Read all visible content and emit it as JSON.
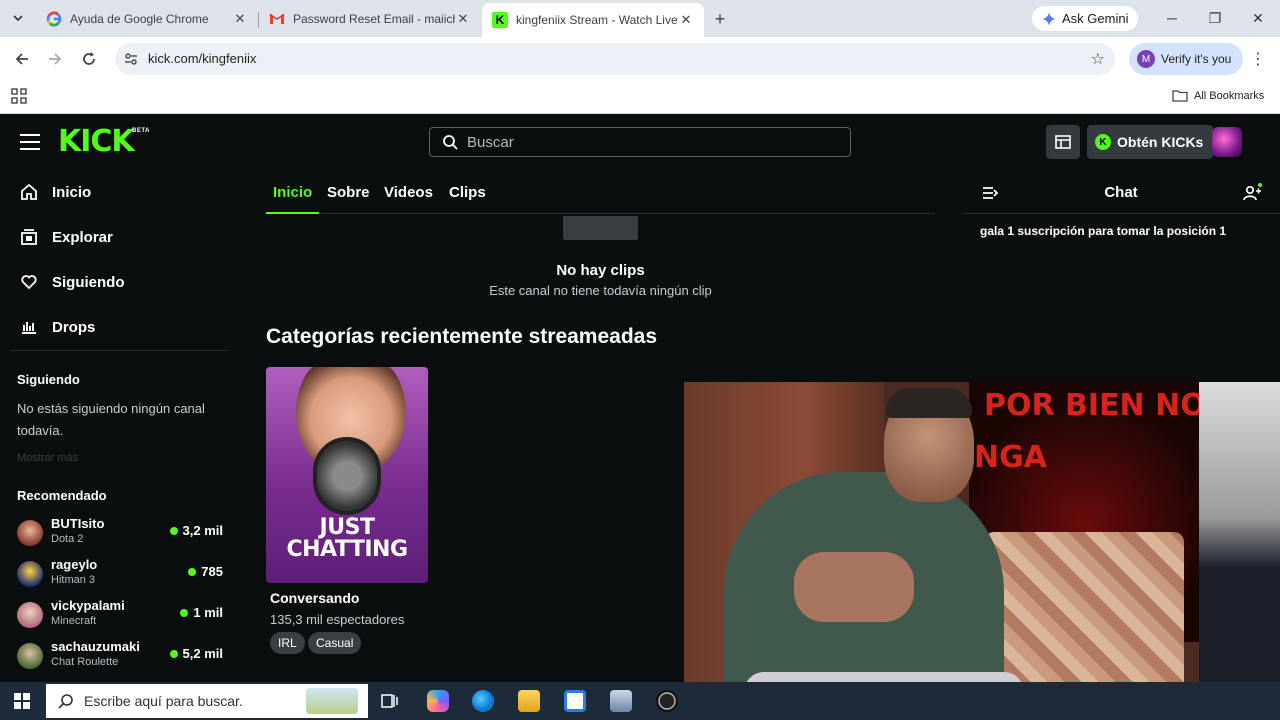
{
  "browser": {
    "tabs": [
      {
        "title": "Ayuda de Google Chrome",
        "favicon": "google-icon"
      },
      {
        "title": "Password Reset Email - maiiche",
        "favicon": "gmail-icon"
      },
      {
        "title": "kingfeniix Stream - Watch Live o",
        "favicon": "kick-icon",
        "active": true
      }
    ],
    "ask_gemini": "Ask Gemini",
    "url": "kick.com/kingfeniix",
    "profile_label": "Verify it's you",
    "profile_initial": "M",
    "bookmarks_label": "All Bookmarks"
  },
  "kick": {
    "logo": "KICK",
    "logo_badge": "BETA",
    "search_placeholder": "Buscar",
    "get_kicks": "Obtén KICKs",
    "accent": "#53fc18",
    "sidebar": {
      "nav": [
        {
          "label": "Inicio",
          "icon": "home-icon"
        },
        {
          "label": "Explorar",
          "icon": "explore-icon"
        },
        {
          "label": "Siguiendo",
          "icon": "heart-icon"
        },
        {
          "label": "Drops",
          "icon": "drops-icon"
        }
      ],
      "following_heading": "Siguiendo",
      "following_empty": "No estás siguiendo ningún canal todavía.",
      "show_more": "Mostrar más",
      "recommended_heading": "Recomendado",
      "recommended": [
        {
          "name": "BUTIsito",
          "game": "Dota 2",
          "viewers": "3,2 mil"
        },
        {
          "name": "rageylo",
          "game": "Hitman 3",
          "viewers": "785"
        },
        {
          "name": "vickypalami",
          "game": "Minecraft",
          "viewers": "1 mil"
        },
        {
          "name": "sachauzumaki",
          "game": "Chat Roulette",
          "viewers": "5,2 mil"
        }
      ]
    },
    "channel_tabs": [
      "Inicio",
      "Sobre",
      "Videos",
      "Clips"
    ],
    "no_clips_title": "No hay clips",
    "no_clips_sub": "Este canal no tiene todavía ningún clip",
    "categories_heading": "Categorías recientemente streameadas",
    "category": {
      "card_title_1": "JUST",
      "card_title_2": "CHATTING",
      "name": "Conversando",
      "viewers": "135,3 mil espectadores",
      "tags": [
        "IRL",
        "Casual"
      ]
    },
    "chat": {
      "title": "Chat",
      "pinned": "gala 1 suscripción para tomar la posición 1"
    },
    "webcam_banner_1": "POR BIEN NO",
    "webcam_banner_2": "NGA"
  },
  "taskbar": {
    "search_placeholder": "Escribe aquí para buscar."
  }
}
